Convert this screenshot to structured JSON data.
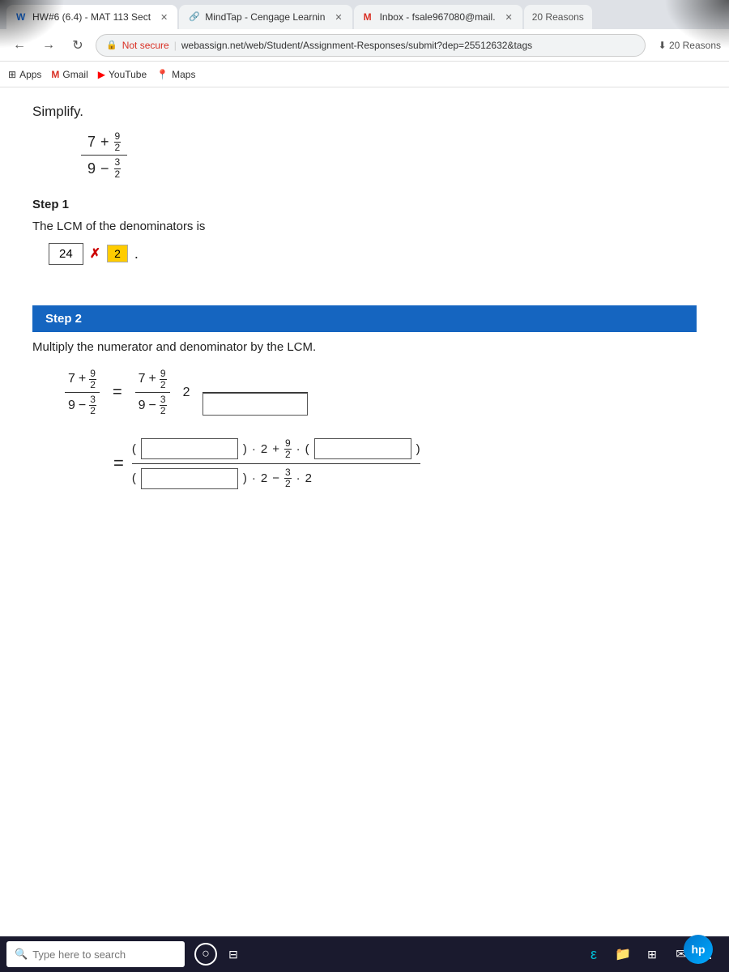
{
  "browser": {
    "tabs": [
      {
        "id": "tab1",
        "label": "HW#6 (6.4) - MAT 113 Sect",
        "active": true,
        "favicon": "W"
      },
      {
        "id": "tab2",
        "label": "MindTap - Cengage Learnin",
        "active": false,
        "favicon": "🔗"
      },
      {
        "id": "tab3",
        "label": "Inbox - fsale967080@mail.",
        "active": false,
        "favicon": "M"
      }
    ],
    "extra_tab": "20 Reasons",
    "nav": {
      "back": "←",
      "forward": "→",
      "reload": "↻",
      "security": "Not secure",
      "url": "webassign.net/web/Student/Assignment-Responses/submit?dep=25512632&tags"
    },
    "bookmarks": [
      {
        "label": "Apps",
        "icon": "⊞"
      },
      {
        "label": "Gmail",
        "icon": "M"
      },
      {
        "label": "YouTube",
        "icon": "▶"
      },
      {
        "label": "Maps",
        "icon": "📍"
      }
    ]
  },
  "content": {
    "simplify_label": "Simplify.",
    "step1": {
      "header": "Step 1",
      "text": "The LCM of the denominators is",
      "answer": "24",
      "answer_correct": "2"
    },
    "step2": {
      "header": "Step 2",
      "text": "Multiply the numerator and denominator by the LCM.",
      "multiplier": "2"
    }
  },
  "taskbar": {
    "search_placeholder": "Type here to search",
    "icons": [
      "⊞",
      "💬",
      "🔍"
    ]
  }
}
